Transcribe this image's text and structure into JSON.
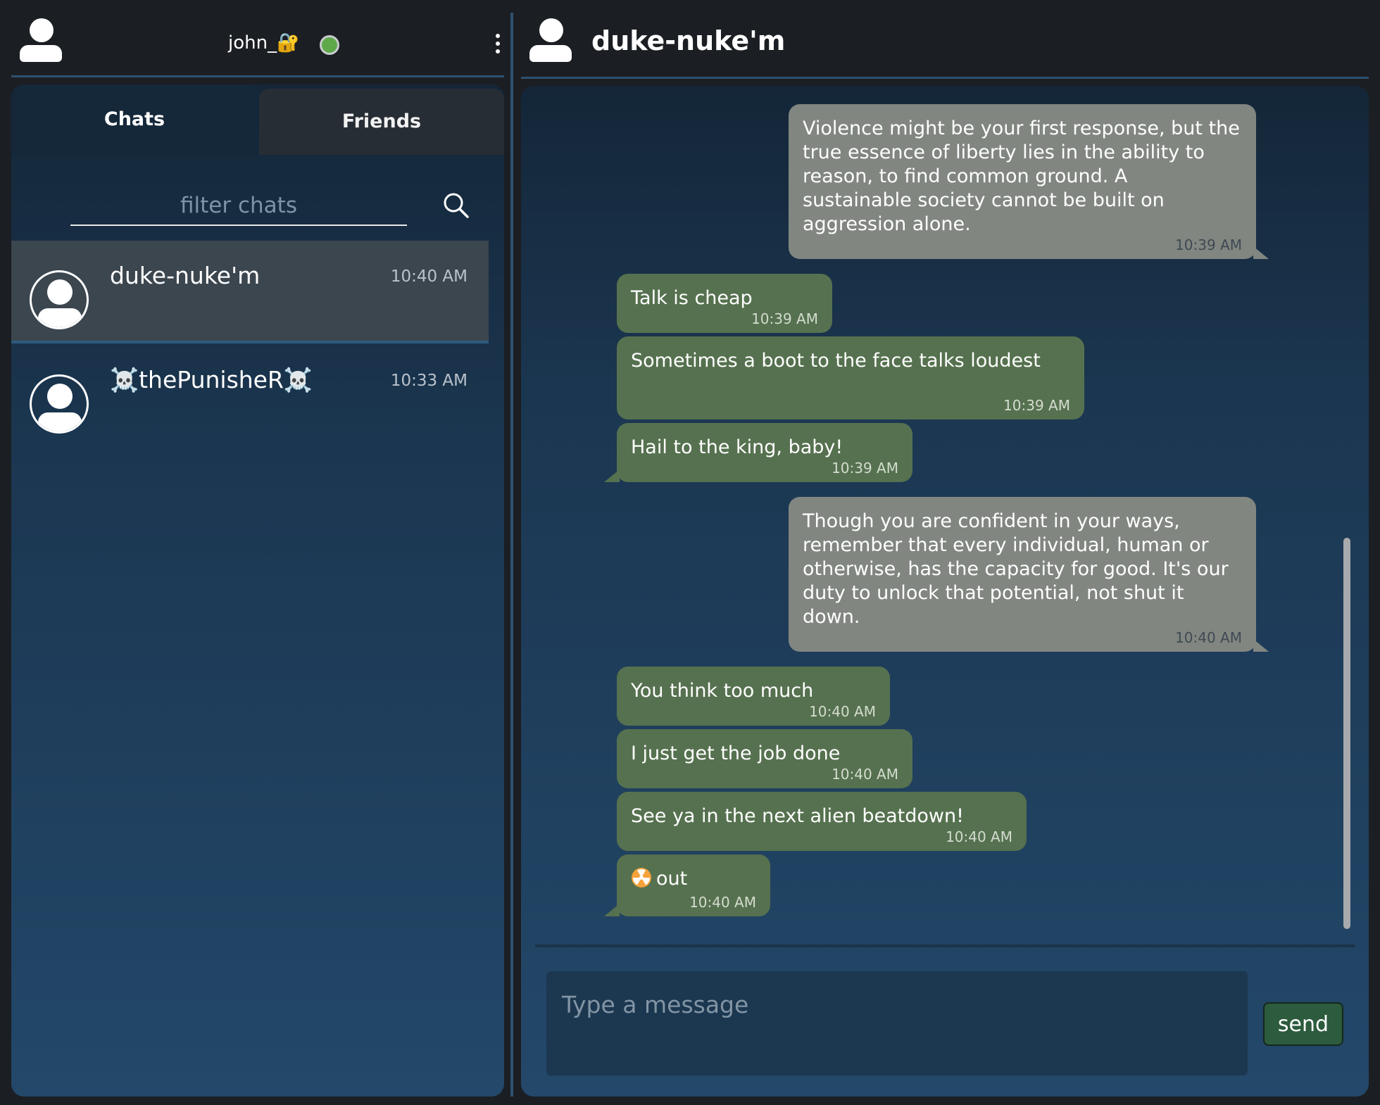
{
  "user": {
    "username": "john_🔐",
    "status": "online"
  },
  "tabs": [
    {
      "label": "Chats",
      "active": true
    },
    {
      "label": "Friends",
      "active": false
    }
  ],
  "filter": {
    "placeholder": "filter chats"
  },
  "chats": [
    {
      "name": "duke-nuke'm",
      "time": "10:40 AM",
      "active": true
    },
    {
      "name": "☠️thePunisheR☠️",
      "time": "10:33 AM",
      "active": false
    }
  ],
  "conversation": {
    "peer_name": "duke-nuke'm",
    "messages": [
      {
        "direction": "outgoing",
        "text": "Violence might be your first response, but the true essence of liberty lies in the ability to reason, to find common ground. A sustainable society cannot be built on aggression alone.",
        "time": "10:39 AM"
      },
      {
        "direction": "incoming",
        "text": "Talk is cheap",
        "time": "10:39 AM"
      },
      {
        "direction": "incoming",
        "text": "Sometimes a boot to the face talks loudest",
        "time": "10:39 AM"
      },
      {
        "direction": "incoming",
        "text": "Hail to the king, baby!",
        "time": "10:39 AM"
      },
      {
        "direction": "outgoing",
        "text": "Though you are confident in your ways, remember that every individual, human or otherwise, has the capacity for good. It's our duty to unlock that potential, not shut it down.",
        "time": "10:40 AM"
      },
      {
        "direction": "incoming",
        "text": "You think too much",
        "time": "10:40 AM"
      },
      {
        "direction": "incoming",
        "text": "I just get the job done",
        "time": "10:40 AM"
      },
      {
        "direction": "incoming",
        "text": "See ya in the next alien beatdown!",
        "time": "10:40 AM"
      },
      {
        "direction": "incoming",
        "text": "out",
        "time": "10:40 AM",
        "icon": "radioactive-icon"
      }
    ]
  },
  "composer": {
    "placeholder": "Type a message",
    "send_label": "send"
  },
  "colors": {
    "incoming_bubble": "#56714f",
    "outgoing_bubble": "#818681",
    "send_button": "#2c5b3d",
    "online_dot": "#5fa94a",
    "accent_border": "#2d5170"
  }
}
